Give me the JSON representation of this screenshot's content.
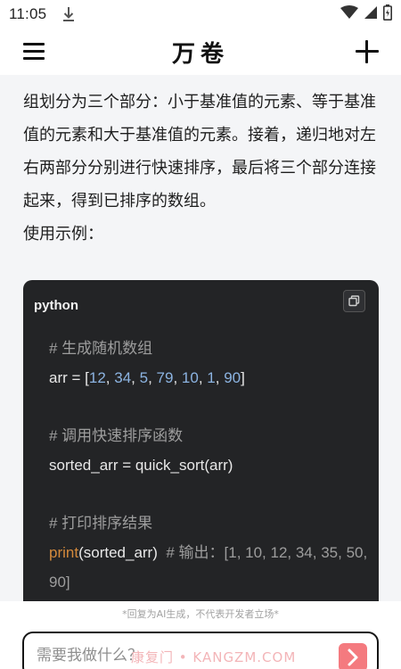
{
  "status_bar": {
    "time": "11:05"
  },
  "header": {
    "title": "万卷"
  },
  "answer": {
    "paragraphs": [
      "组划分为三个部分：小于基准值的元素、等于基准值的元素和大于基准值的元素。接着，递归地对左右两部分分别进行快速排序，最后将三个部分连接起来，得到已排序的数组。",
      "使用示例："
    ]
  },
  "code_block": {
    "language": "python",
    "lines": {
      "c1": "# 生成随机数组",
      "l2_a": "arr = [",
      "l2_nums": [
        "12",
        "34",
        "5",
        "79",
        "10",
        "1",
        "90"
      ],
      "l2_b": "]",
      "c2": "# 调用快速排序函数",
      "l5": "sorted_arr = quick_sort(arr)",
      "c3": "# 打印排序结果",
      "l8_fn": "print",
      "l8_arg": "(sorted_arr)",
      "l8_cm": "# 输出：[1, 10, 12, 34, 35, 50,",
      "l9": "90]"
    }
  },
  "disclaimer": "*回复为AI生成，不代表开发者立场*",
  "input": {
    "placeholder": "需要我做什么？",
    "watermark": "康复门 • KANGZM.COM"
  },
  "colors": {
    "code_bg": "#232426",
    "number": "#8cb4e2",
    "builtin_fn": "#d48a3c",
    "send_button": "#f47a7f"
  }
}
